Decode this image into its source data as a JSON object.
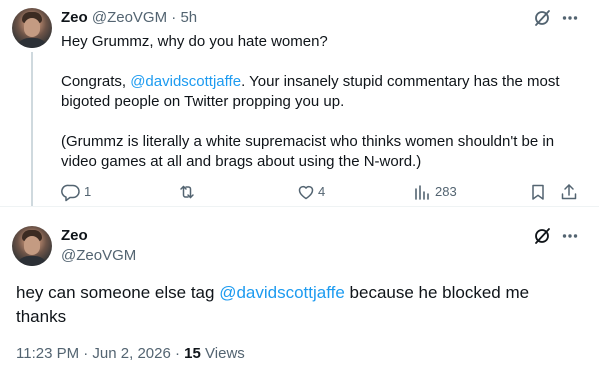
{
  "reply_tweet": {
    "author_name": "Zeo",
    "author_handle": "@ZeoVGM",
    "separator": "·",
    "time": "5h",
    "line1": "Hey Grummz, why do you hate women?",
    "para2_prefix": "Congrats, ",
    "mention": "@davidscottjaffe",
    "para2_rest_line1": ". Your insanely stupid commentary has the most",
    "para2_line2": "bigoted people on Twitter propping you up.",
    "para3_line1": "(Grummz is literally a white supremacist who thinks women shouldn't be in",
    "para3_line2": "video games at all and brags about using the N-word.)",
    "replies_count": "1",
    "likes_count": "4",
    "views_count": "283"
  },
  "main_tweet": {
    "author_name": "Zeo",
    "author_handle": "@ZeoVGM",
    "text_before": "hey can someone else tag ",
    "mention": "@davidscottjaffe",
    "text_after_line1": " because he blocked me",
    "text_line2": "thanks",
    "timestamp": "11:23 PM · Jun 2, 2026",
    "meta_separator": "·",
    "views_count": "15",
    "views_label": "Views"
  },
  "icons": {
    "grok": "grok-icon",
    "more": "more-icon",
    "reply": "reply-icon",
    "retweet": "retweet-icon",
    "like": "like-icon",
    "views": "views-icon",
    "bookmark": "bookmark-icon",
    "share": "share-icon"
  },
  "colors": {
    "link": "#1d9bf0",
    "muted": "#536471",
    "text": "#0f1419",
    "thread_line": "#cfd9de"
  }
}
